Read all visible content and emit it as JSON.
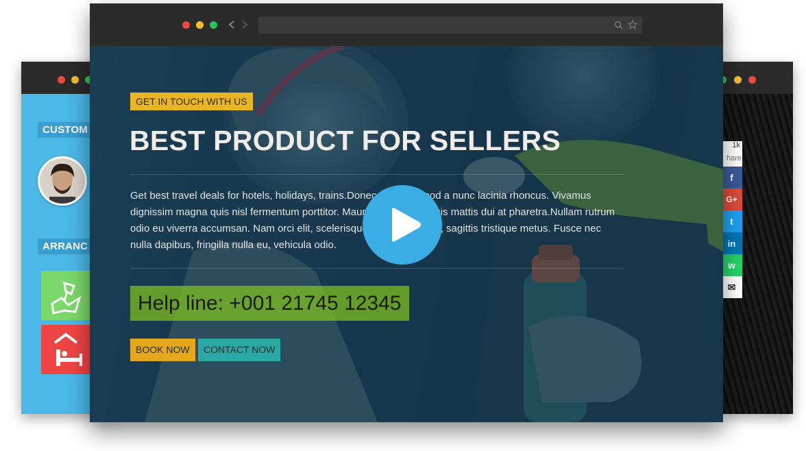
{
  "left_window": {
    "tags": [
      "CUSTOM",
      "ARRANC"
    ]
  },
  "right_window": {
    "share": {
      "count": "1k",
      "label": "hare",
      "buttons": [
        {
          "name": "facebook",
          "glyph": "f",
          "color": "#3b5998"
        },
        {
          "name": "google-plus",
          "glyph": "G+",
          "color": "#dd4b39"
        },
        {
          "name": "twitter",
          "glyph": "t",
          "color": "#1da1f2"
        },
        {
          "name": "linkedin",
          "glyph": "in",
          "color": "#0077b5"
        },
        {
          "name": "whatsapp",
          "glyph": "w",
          "color": "#25d366"
        },
        {
          "name": "email",
          "glyph": "✉",
          "color": "#ffffff"
        }
      ]
    }
  },
  "main_window": {
    "hero": {
      "tag": "GET IN TOUCH WITH US",
      "title": "BEST PRODUCT FOR SELLERS",
      "body": "Get best travel deals for hotels, holidays, trains.Donec eget euismod a nunc lacinia rhoncus. Vivamus dignissim magna quis nisl fermentum porttitor. Mauris eget ipsum quis mattis dui at pharetra.Nullam rutrum odio eu viverra accumsan. Nam orci elit, scelerisque at justo qui non, sagittis tristique metus. Fusce nec nulla dapibus, fringilla nulla eu, vehicula odio.",
      "helpline": "Help line: +001 21745 12345",
      "book_label": "BOOK NOW",
      "contact_label": "CONTACT NOW"
    }
  },
  "colors": {
    "accent_yellow": "#e8b624",
    "accent_teal": "#2aa9a4",
    "play_blue": "#3aaee4",
    "helpline_green": "#82c41e"
  }
}
